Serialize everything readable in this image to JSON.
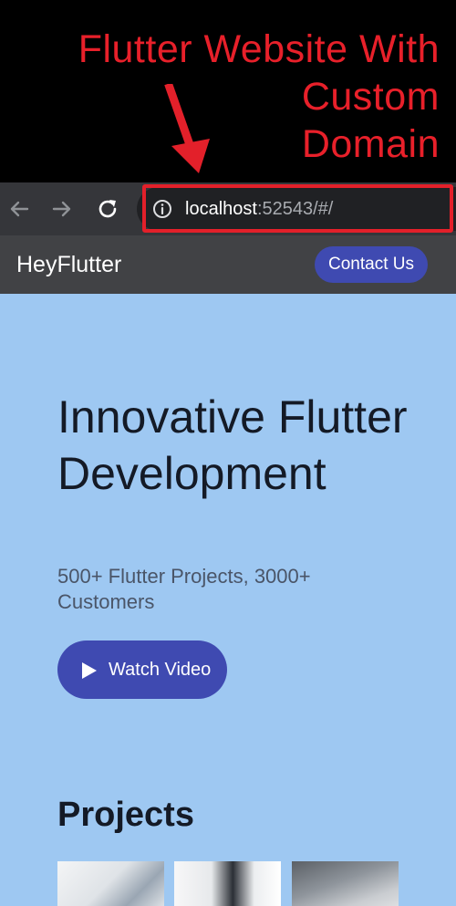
{
  "annotation": {
    "title_lines": [
      "Flutter Website With",
      "Custom",
      "Domain"
    ],
    "color": "#e8202a"
  },
  "browser": {
    "url_host": "localhost",
    "url_rest": ":52543/#/",
    "icons": [
      "back-arrow-icon",
      "forward-arrow-icon",
      "reload-icon",
      "info-icon"
    ]
  },
  "appbar": {
    "title": "HeyFlutter",
    "contact_label": "Contact Us"
  },
  "hero": {
    "title": "Innovative Flutter Development",
    "subtitle": "500+ Flutter Projects, 3000+ Customers",
    "watch_label": "Watch Video",
    "watch_icon": "play-icon"
  },
  "projects": {
    "title": "Projects",
    "thumbnail_count_visible": 3
  },
  "colors": {
    "accent": "#3f4ab1",
    "content_bg": "#9ec8f2",
    "appbar_bg": "#414245",
    "toolbar_bg": "#35363a"
  }
}
